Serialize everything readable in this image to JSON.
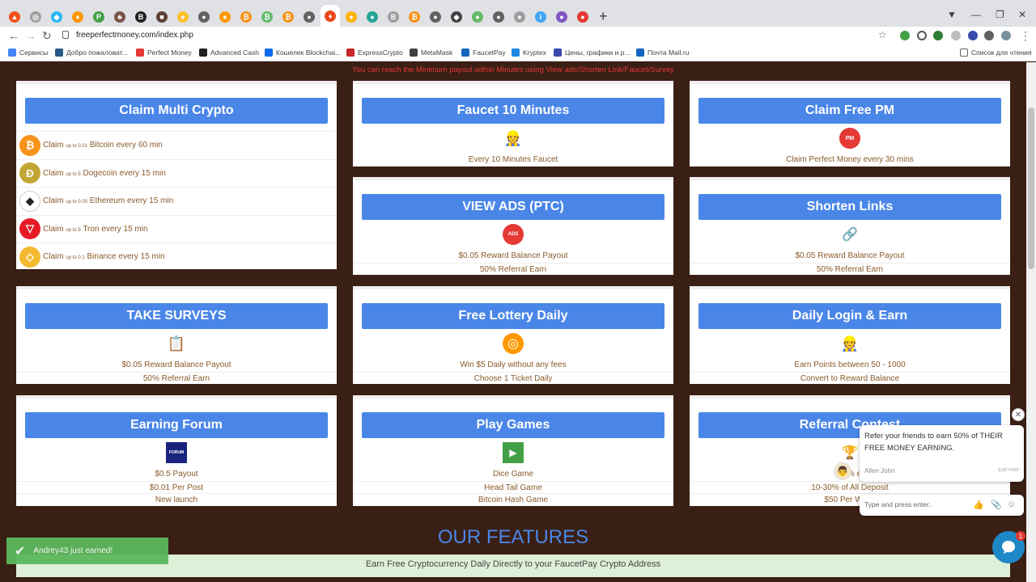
{
  "browser": {
    "url": "freeperfectmoney.com/index.php",
    "tabs": [
      {
        "icon": "drop-icon",
        "color": "#f4511e",
        "glyph": "▲"
      },
      {
        "icon": "coin-icon",
        "color": "#9e9e9e",
        "glyph": "◎"
      },
      {
        "icon": "diamond-icon",
        "color": "#29b6f6",
        "glyph": "◆"
      },
      {
        "icon": "flame-icon",
        "color": "#ff9800",
        "glyph": "♦"
      },
      {
        "icon": "leaf-icon",
        "color": "#43a047",
        "glyph": "P"
      },
      {
        "icon": "tree-icon",
        "color": "#795548",
        "glyph": "♣"
      },
      {
        "icon": "b-icon",
        "color": "#212121",
        "glyph": "B"
      },
      {
        "icon": "pixel-icon",
        "color": "#5d4037",
        "glyph": "■"
      },
      {
        "icon": "circle-icon",
        "color": "#fbc02d",
        "glyph": "●"
      },
      {
        "icon": "globe-icon",
        "color": "#616161",
        "glyph": "●"
      },
      {
        "icon": "orange-icon",
        "color": "#ff9800",
        "glyph": "●"
      },
      {
        "icon": "bitcoin-icon",
        "color": "#f7931a",
        "glyph": "₿"
      },
      {
        "icon": "green-coin-icon",
        "color": "#66bb6a",
        "glyph": "₿"
      },
      {
        "icon": "bitcoin-icon",
        "color": "#f7931a",
        "glyph": "₿"
      },
      {
        "icon": "globe-icon",
        "color": "#616161",
        "glyph": "●"
      },
      {
        "icon": "faucet-icon",
        "color": "#e64a19",
        "glyph": "♦"
      },
      {
        "icon": "bird-icon",
        "color": "#ffb300",
        "glyph": "●"
      },
      {
        "icon": "chat-icon",
        "color": "#26a69a",
        "glyph": "●"
      },
      {
        "icon": "btc-text-icon",
        "color": "#9e9e9e",
        "glyph": "B"
      },
      {
        "icon": "bitcoin-icon",
        "color": "#f7931a",
        "glyph": "₿"
      },
      {
        "icon": "globe-icon",
        "color": "#616161",
        "glyph": "●"
      },
      {
        "icon": "eth-icon",
        "color": "#424242",
        "glyph": "◆"
      },
      {
        "icon": "green-coin-icon",
        "color": "#66bb6a",
        "glyph": "●"
      },
      {
        "icon": "globe-icon",
        "color": "#616161",
        "glyph": "●"
      },
      {
        "icon": "grey-coin-icon",
        "color": "#9e9e9e",
        "glyph": "●"
      },
      {
        "icon": "info-icon",
        "color": "#42a5f5",
        "glyph": "i"
      },
      {
        "icon": "purple-coin-icon",
        "color": "#7e57c2",
        "glyph": "●"
      },
      {
        "icon": "red-coin-icon",
        "color": "#e53935",
        "glyph": "●"
      }
    ],
    "bookmarks": [
      {
        "label": "Сервисы",
        "color": "#4285f4"
      },
      {
        "label": "Добро пожаловат...",
        "color": "#2a5885"
      },
      {
        "label": "Perfect Money",
        "color": "#e53935"
      },
      {
        "label": "Advanced Cash",
        "color": "#212121"
      },
      {
        "label": "Кошелек Blockchai...",
        "color": "#0c6cf2"
      },
      {
        "label": "ExpressCrypto",
        "color": "#c62828"
      },
      {
        "label": "MetaMask",
        "color": "#424242"
      },
      {
        "label": "FaucetPay",
        "color": "#1565c0"
      },
      {
        "label": "Kryptex",
        "color": "#1e88e5"
      },
      {
        "label": "Цены, графики и р...",
        "color": "#3949ab"
      },
      {
        "label": "Почта Mail.ru",
        "color": "#1565c0"
      }
    ],
    "reading_list": "Список для чтения"
  },
  "page": {
    "top_note": "You can reach the Minimum payout within Minutes using View ads/Shorten Link/Faucet/Survey",
    "multi_crypto": {
      "title": "Claim Multi Crypto",
      "coins": [
        {
          "icon": "bitcoin-icon",
          "color": "#f7931a",
          "glyph": "₿",
          "claim": "Claim",
          "amount": "up to 0.01",
          "text": "Bitcoin every 60 min"
        },
        {
          "icon": "dogecoin-icon",
          "color": "#c2a633",
          "glyph": "Ð",
          "claim": "Claim",
          "amount": "up to 5",
          "text": "Dogecoin every 15 min"
        },
        {
          "icon": "ethereum-icon",
          "color": "#ffffff",
          "glyph": "◆",
          "claim": "Claim",
          "amount": "up to 0.05",
          "text": "Ethereum every 15 min"
        },
        {
          "icon": "tron-icon",
          "color": "#e51a24",
          "glyph": "▽",
          "claim": "Claim",
          "amount": "up to 5",
          "text": "Tron every 15 min"
        },
        {
          "icon": "binance-icon",
          "color": "#f3ba2f",
          "glyph": "◇",
          "claim": "Claim",
          "amount": "up to 0.1",
          "text": "Binance every 15 min"
        }
      ]
    },
    "cards": [
      {
        "key": "faucet",
        "title": "Faucet 10 Minutes",
        "icon": "worker-icon",
        "glyph": "👷",
        "lines": [
          "Every 10 Minutes Faucet"
        ]
      },
      {
        "key": "claim-pm",
        "title": "Claim Free PM",
        "icon": "perfect-money-icon",
        "glyph": "PM",
        "lines": [
          "Claim Perfect Money every 30 mins"
        ]
      },
      {
        "key": "view-ads",
        "title": "VIEW ADS (PTC)",
        "icon": "ads-icon",
        "glyph": "ADS",
        "lines": [
          "$0.05 Reward Balance Payout",
          "50% Referral Earn"
        ]
      },
      {
        "key": "shorten",
        "title": "Shorten Links",
        "icon": "link-icon",
        "glyph": "🔗",
        "lines": [
          "$0.05 Reward Balance Payout",
          "50% Referral Earn"
        ]
      },
      {
        "key": "surveys",
        "title": "TAKE SURVEYS",
        "icon": "clipboard-icon",
        "glyph": "📋",
        "lines": [
          "$0.05 Reward Balance Payout",
          "50% Referral Earn"
        ]
      },
      {
        "key": "lottery",
        "title": "Free Lottery Daily",
        "icon": "lottery-wheel-icon",
        "glyph": "◎",
        "lines": [
          "Win $5 Daily without any fees",
          "Choose 1 Ticket Daily"
        ]
      },
      {
        "key": "daily-login",
        "title": "Daily Login & Earn",
        "icon": "worker-icon",
        "glyph": "👷",
        "lines": [
          "Earn Points between 50 - 1000",
          "Convert to Reward Balance"
        ]
      },
      {
        "key": "forum",
        "title": "Earning Forum",
        "icon": "forum-icon",
        "glyph": "FORUM",
        "lines": [
          "$0.5 Payout",
          "$0.01 Per Post",
          "New launch"
        ]
      },
      {
        "key": "games",
        "title": "Play Games",
        "icon": "play-games-icon",
        "glyph": "▶",
        "lines": [
          "Dice Game",
          "Head Tail Game",
          "Bitcoin Hash Game"
        ]
      },
      {
        "key": "referral",
        "title": "Referral Contest",
        "icon": "referral-icon",
        "glyph": "🏆",
        "lines": [
          "50% e",
          "10-30% of All Deposit",
          "$50 Per Week"
        ]
      }
    ],
    "features_title": "OUR FEATURES",
    "features_bar": "Earn Free Cryptocurrency Daily Directly to your FaucetPay Crypto Address",
    "toast": "Andrey43 just earned!"
  },
  "chat": {
    "message": "Refer your friends to earn 50% of THEIR FREE MONEY EARNING.",
    "author": "Allen John",
    "time": "just now",
    "input_placeholder": "Type and press enter..",
    "badge_count": "1"
  },
  "colors": {
    "accent_blue": "#4a86e8",
    "page_bg": "#3a1f14",
    "note_red": "#e53935",
    "toast_green": "#5cb85c"
  }
}
